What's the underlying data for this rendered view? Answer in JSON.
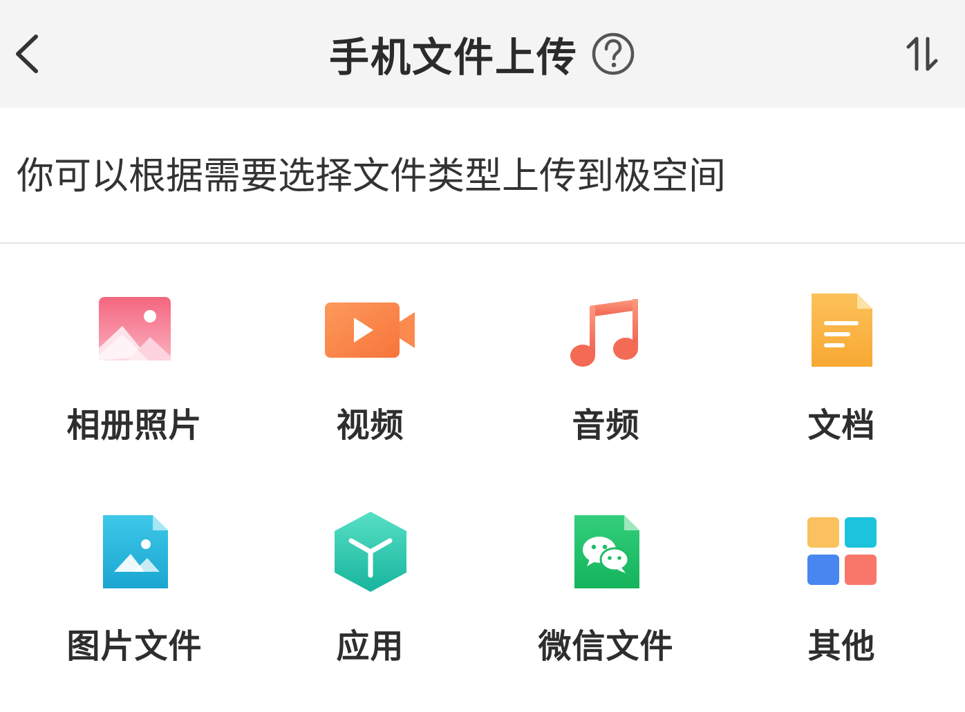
{
  "header": {
    "title": "手机文件上传",
    "back_icon": "chevron-left-icon",
    "help_icon": "question-circle-icon",
    "sort_icon": "transfer-arrows-icon"
  },
  "description": "你可以根据需要选择文件类型上传到极空间",
  "categories": [
    {
      "label": "相册照片",
      "icon": "photo-album-icon"
    },
    {
      "label": "视频",
      "icon": "video-icon"
    },
    {
      "label": "音频",
      "icon": "music-note-icon"
    },
    {
      "label": "文档",
      "icon": "document-icon"
    },
    {
      "label": "图片文件",
      "icon": "image-file-icon"
    },
    {
      "label": "应用",
      "icon": "app-cube-icon"
    },
    {
      "label": "微信文件",
      "icon": "wechat-file-icon"
    },
    {
      "label": "其他",
      "icon": "grid-apps-icon"
    }
  ],
  "colors": {
    "header_bg": "#f4f4f4",
    "photo": "#f06a8c",
    "video": "#fb8a4f",
    "music": "#f3705c",
    "document": "#fbb93f",
    "image_file": "#27b6dc",
    "app": "#2fd1b7",
    "wechat": "#21c16b"
  }
}
